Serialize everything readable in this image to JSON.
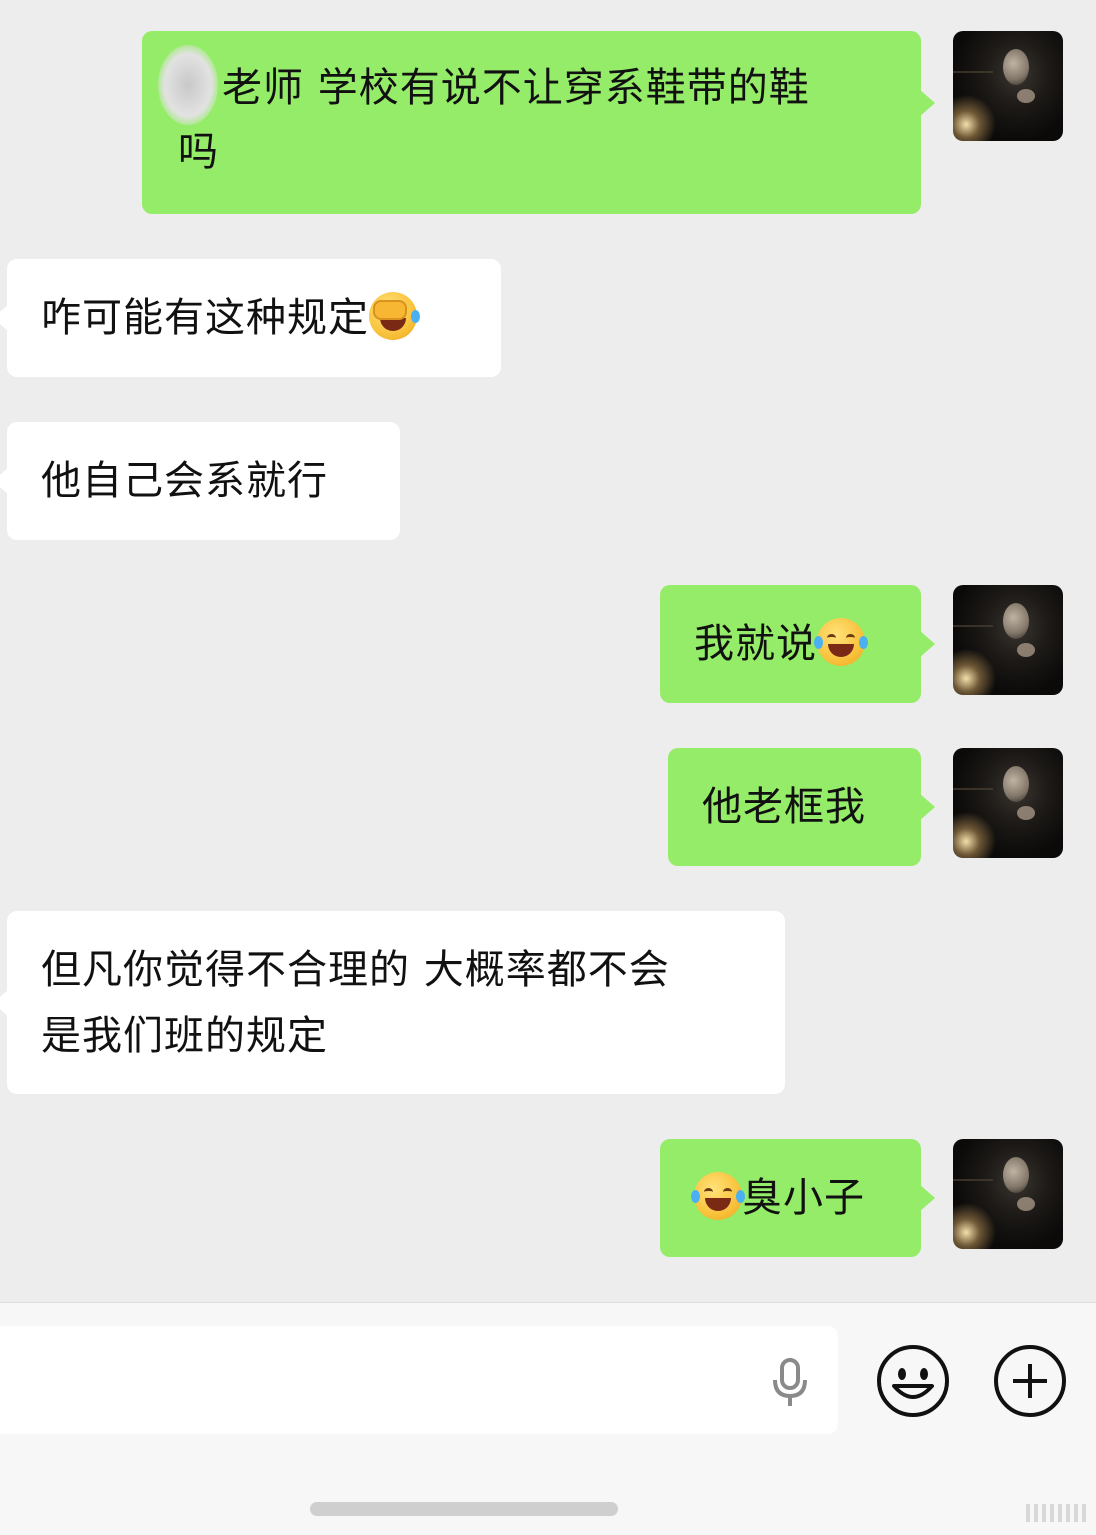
{
  "messages": [
    {
      "direction": "out",
      "text": "老师 学校有说不让穿系鞋带的鞋吗",
      "line1": "老师 学校有说不让穿系鞋带的鞋",
      "line2": "吗"
    },
    {
      "direction": "in",
      "text": "咋可能有这种规定",
      "emoji": "face-palm-emoji"
    },
    {
      "direction": "in",
      "text": "他自己会系就行"
    },
    {
      "direction": "out",
      "text": "我就说",
      "emoji": "tears-of-joy-emoji"
    },
    {
      "direction": "out",
      "text": "他老框我"
    },
    {
      "direction": "in",
      "line1": "但凡你觉得不合理的 大概率都不会",
      "line2": "是我们班的规定"
    },
    {
      "direction": "out",
      "emoji": "tears-of-joy-emoji",
      "text": "臭小子"
    }
  ],
  "input_bar": {
    "icons": [
      "microphone-icon",
      "emoji-icon",
      "plus-icon"
    ]
  },
  "colors": {
    "background": "#ededed",
    "outgoing_bubble": "#95ec69",
    "incoming_bubble": "#ffffff"
  }
}
